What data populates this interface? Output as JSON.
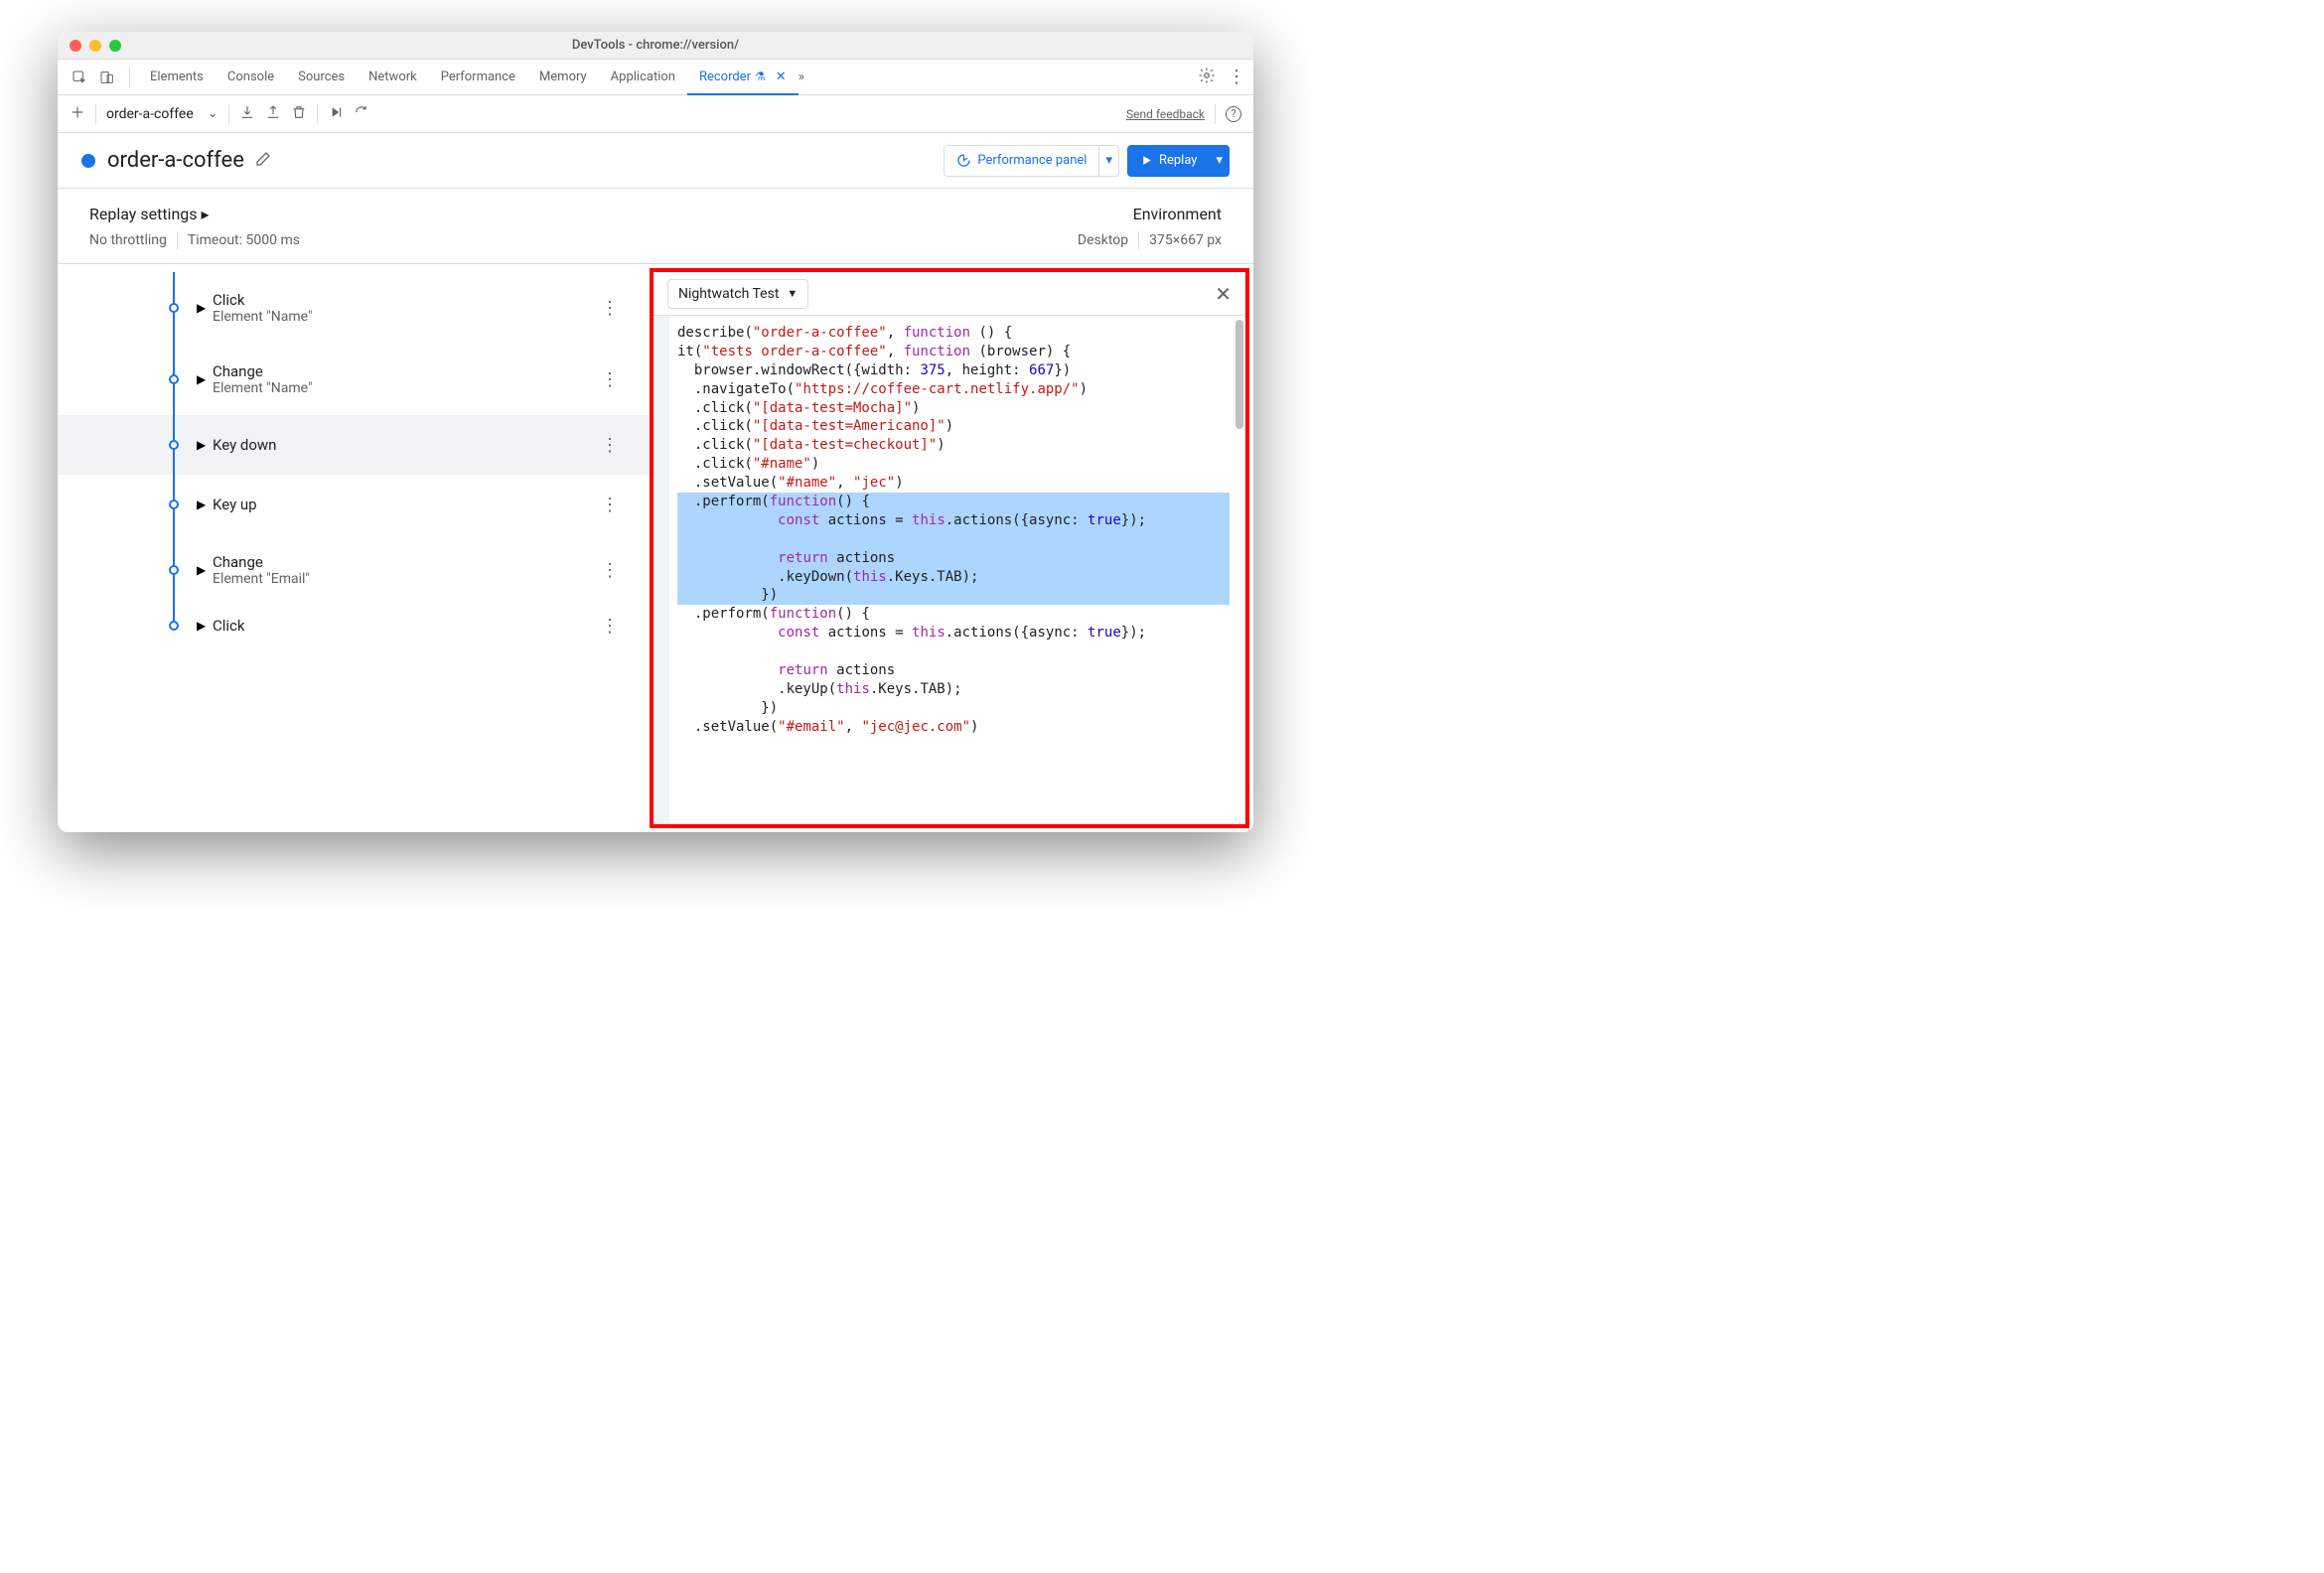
{
  "window_title": "DevTools - chrome://version/",
  "tabs": [
    "Elements",
    "Console",
    "Sources",
    "Network",
    "Performance",
    "Memory",
    "Application",
    "Recorder"
  ],
  "active_tab": "Recorder",
  "recording_name": "order-a-coffee",
  "send_feedback": "Send feedback",
  "title": "order-a-coffee",
  "perf_btn": "Performance panel",
  "replay_btn": "Replay",
  "replay_settings": "Replay settings",
  "environment_label": "Environment",
  "throttle": "No throttling",
  "timeout": "Timeout: 5000 ms",
  "env_device": "Desktop",
  "env_dims": "375×667 px",
  "export_format": "Nightwatch Test",
  "steps": [
    {
      "title": "Click",
      "sub": "Element \"Name\""
    },
    {
      "title": "Change",
      "sub": "Element \"Name\""
    },
    {
      "title": "Key down",
      "sub": ""
    },
    {
      "title": "Key up",
      "sub": ""
    },
    {
      "title": "Change",
      "sub": "Element \"Email\""
    },
    {
      "title": "Click",
      "sub": ""
    }
  ],
  "code": {
    "describe_name": "\"order-a-coffee\"",
    "it_name": "\"tests order-a-coffee\"",
    "width": "375",
    "height": "667",
    "url": "\"https://coffee-cart.netlify.app/\"",
    "sel_mocha": "\"[data-test=Mocha]\"",
    "sel_americano": "\"[data-test=Americano]\"",
    "sel_checkout": "\"[data-test=checkout]\"",
    "sel_name": "\"#name\"",
    "val_jec": "\"jec\"",
    "sel_email": "\"#email\"",
    "val_email": "\"jec@jec.com\""
  }
}
